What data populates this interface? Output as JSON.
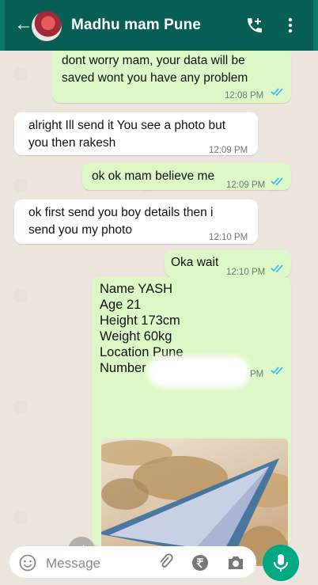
{
  "header": {
    "contact_name": "Madhu mam Pune",
    "bg_color": "#075e54"
  },
  "messages": [
    {
      "direction": "outgoing",
      "text": "dont worry mam, your data will be saved wont you have any problem",
      "time": "12:08 PM",
      "status": "read"
    },
    {
      "direction": "incoming",
      "text": "alright Ill send it You see a photo but you then rakesh",
      "time": "12:09 PM"
    },
    {
      "direction": "outgoing",
      "text": "ok ok mam believe me",
      "time": "12:09 PM",
      "status": "read"
    },
    {
      "direction": "incoming",
      "text": "ok first send you boy details then i send you my photo",
      "time": "12:10 PM"
    },
    {
      "direction": "outgoing",
      "text": "Oka wait",
      "time": "12:10 PM",
      "status": "read"
    },
    {
      "direction": "outgoing",
      "lines": [
        "Name YASH",
        "Age 21",
        "Height 173cm",
        "Weight 60kg",
        "Location Pune",
        "Number"
      ],
      "time": "PM",
      "status": "read"
    }
  ],
  "input": {
    "placeholder": "Message"
  },
  "icons": {
    "back": "back-arrow-icon",
    "call": "add-call-icon",
    "menu": "more-vert-icon",
    "forward": "forward-icon",
    "scroll": "chevron-double-down-icon",
    "emoji": "emoji-icon",
    "attach": "paperclip-icon",
    "payment": "rupee-icon",
    "camera": "camera-icon",
    "mic": "mic-icon"
  },
  "colors": {
    "outgoing_bubble": "#dcf8c6",
    "incoming_bubble": "#ffffff",
    "read_ticks": "#34b7f1",
    "mic_button": "#00a884",
    "chat_bg": "#ece5dd"
  }
}
